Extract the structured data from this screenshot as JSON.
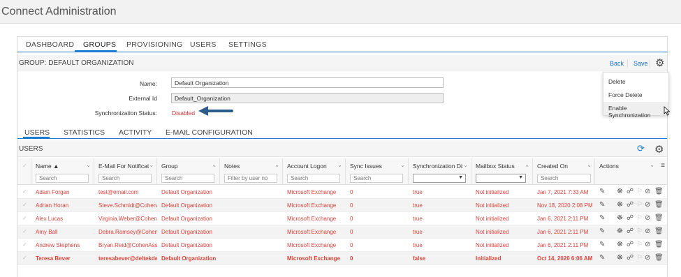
{
  "app": {
    "title": "Connect Administration"
  },
  "main_tabs": [
    "DASHBOARD",
    "GROUPS",
    "PROVISIONING",
    "USERS",
    "SETTINGS"
  ],
  "group": {
    "title": "GROUP: DEFAULT ORGANIZATION",
    "back_label": "Back",
    "save_label": "Save"
  },
  "gear_menu": {
    "items": [
      "Delete",
      "Force Delete",
      "Enable Synchronization"
    ]
  },
  "form": {
    "name_label": "Name:",
    "name_value": "Default Organization",
    "external_id_label": "External Id",
    "external_id_value": "Default_Organization",
    "sync_status_label": "Synchronization Status:",
    "sync_status_value": "Disabled"
  },
  "sub_tabs": [
    "USERS",
    "STATISTICS",
    "ACTIVITY",
    "E-MAIL CONFIGURATION"
  ],
  "users_panel": {
    "title": "USERS"
  },
  "grid": {
    "columns": [
      "Name ▲",
      "E-Mail For Notificat:",
      "Group",
      "Notes",
      "Account Logon",
      "Sync Issues",
      "Synchronization Di:",
      "Mailbox Status",
      "Created On",
      "Actions"
    ],
    "filter_placeholders": [
      "Search",
      "Search",
      "Search",
      "Filter by user no",
      "Search",
      "Search",
      "",
      "",
      "Search"
    ],
    "rows": [
      [
        "Adam Forgan",
        "test@email.com",
        "Default Organization",
        "",
        "Microsoft Exchange",
        "0",
        "true",
        "Not initialized",
        "Jan 7, 2021 7:33 AM"
      ],
      [
        "Adrian Horan",
        "Steve.Schmidt@CohenA...",
        "Default Organization",
        "",
        "Microsoft Exchange",
        "0",
        "true",
        "Not initialized",
        "Nov 18, 2020 2:08 PM"
      ],
      [
        "Alex Lucas",
        "Virginia.Weber@CohenA...",
        "Default Organization",
        "",
        "Microsoft Exchange",
        "0",
        "true",
        "Not initialized",
        "Jan 6, 2021 2:11 PM"
      ],
      [
        "Amy Ball",
        "Debra.Ramsey@CohenA...",
        "Default Organization",
        "",
        "Microsoft Exchange",
        "0",
        "true",
        "Not initialized",
        "Jan 6, 2021 2:11 PM"
      ],
      [
        "Andrew Stephens",
        "Bryan.Reid@CohenAss...",
        "Default Organization",
        "",
        "Microsoft Exchange",
        "0",
        "true",
        "Not initialized",
        "Jan 6, 2021 2:11 PM"
      ],
      [
        "Teresa Bever",
        "teresabever@deltekde...",
        "Default Organization",
        "",
        "Microsoft Exchange",
        "0",
        "false",
        "Initialized",
        "Oct 14, 2020 6:06 AM"
      ]
    ]
  },
  "colors": {
    "accent": "#1a7bd3",
    "row_text": "#d9413a",
    "disabled": "#cc3333"
  }
}
